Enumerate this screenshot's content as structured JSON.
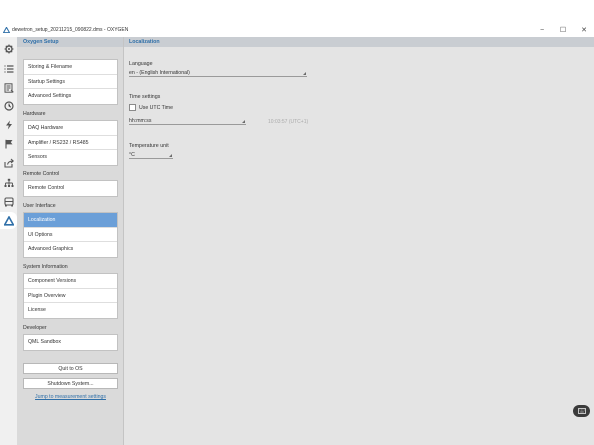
{
  "window": {
    "title": "dewetron_setup_20211215_090822.dms - OXYGEN",
    "minimize_glyph": "−",
    "maximize_glyph": "☐",
    "close_glyph": "✕",
    "logo_icon": "oxygen-logo-icon"
  },
  "icon_strip": {
    "items": [
      {
        "icon": "gear-icon"
      },
      {
        "icon": "list-icon"
      },
      {
        "icon": "report-icon"
      },
      {
        "icon": "clock-icon"
      },
      {
        "icon": "lightning-icon"
      },
      {
        "icon": "flag-icon"
      },
      {
        "icon": "export-icon"
      },
      {
        "icon": "network-icon"
      },
      {
        "icon": "vehicle-icon"
      },
      {
        "icon": "oxygen-logo-icon",
        "active": true
      }
    ]
  },
  "nav": {
    "header": "Oxygen Setup",
    "groups": [
      {
        "title": "",
        "items": [
          "Storing & Filename",
          "Startup Settings",
          "Advanced Settings"
        ]
      },
      {
        "title": "Hardware",
        "items": [
          "DAQ Hardware",
          "Amplifier / RS232 / RS485",
          "Sensors"
        ]
      },
      {
        "title": "Remote Control",
        "items": [
          "Remote Control"
        ]
      },
      {
        "title": "User Interface",
        "items": [
          "Localization",
          "UI Options",
          "Advanced Graphics"
        ],
        "selected": 0
      },
      {
        "title": "System Information",
        "items": [
          "Component Versions",
          "Plugin Overview",
          "License"
        ]
      },
      {
        "title": "Developer",
        "items": [
          "QML Sandbox"
        ]
      }
    ],
    "quit_label": "Quit to OS",
    "shutdown_label": "Shutdown System...",
    "jump_link": "Jump to measurement settings"
  },
  "main": {
    "header": "Localization",
    "language_label": "Language",
    "language_value": "en - (English International)",
    "time_settings_label": "Time settings",
    "use_utc_label": "Use UTC Time",
    "use_utc_checked": false,
    "time_format_value": "hh:mm:ss",
    "time_preview": "10:03:57 (UTC+1)",
    "temperature_label": "Temperature unit",
    "temperature_value": "°C"
  },
  "fab": {
    "icon": "keyboard-icon"
  },
  "colors": {
    "accent": "#2f6fa8",
    "selected_bg": "#6b9fd8",
    "panel_bg": "#dadada",
    "header_bg": "#c9cdd2"
  }
}
